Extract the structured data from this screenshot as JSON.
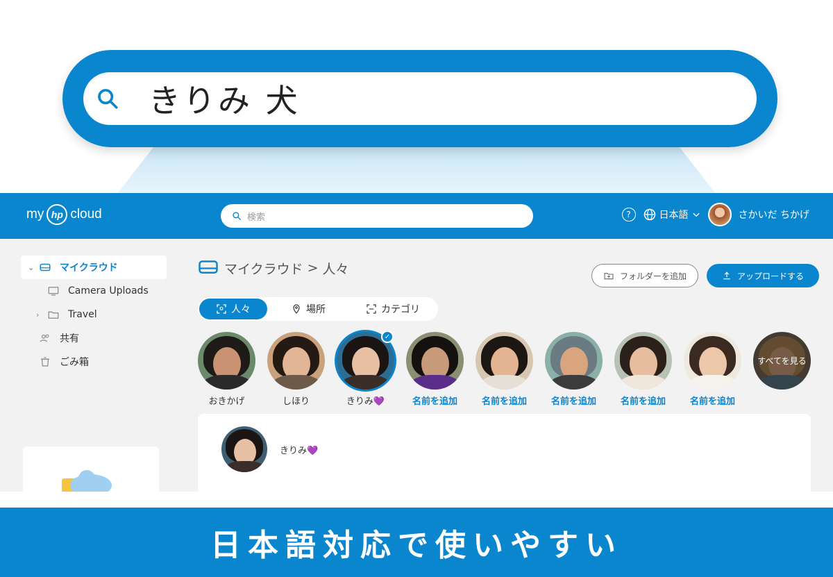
{
  "zoom": {
    "query": "きりみ 犬"
  },
  "header": {
    "logo": {
      "my": "my",
      "hp": "hp",
      "cloud": "cloud"
    },
    "search_placeholder": "検索",
    "help_icon": "?",
    "language": "日本語",
    "user_name": "さかいだ ちかげ"
  },
  "sidebar": {
    "items": [
      {
        "label": "マイクラウド"
      },
      {
        "label": "Camera Uploads"
      },
      {
        "label": "Travel"
      },
      {
        "label": "共有"
      },
      {
        "label": "ごみ箱"
      }
    ]
  },
  "main": {
    "breadcrumb": {
      "root": "マイクラウド",
      "sep": ">",
      "current": "人々"
    },
    "add_folder_label": "フォルダーを追加",
    "upload_label": "アップロードする",
    "tabs": [
      {
        "label": "人々"
      },
      {
        "label": "場所"
      },
      {
        "label": "カテゴリ"
      }
    ],
    "people": [
      {
        "name": "おきかげ"
      },
      {
        "name": "しほり"
      },
      {
        "name": "きりみ💜"
      },
      {
        "name": "名前を追加"
      },
      {
        "name": "名前を追加"
      },
      {
        "name": "名前を追加"
      },
      {
        "name": "名前を追加"
      },
      {
        "name": "名前を追加"
      }
    ],
    "see_all_label": "すべてを見る",
    "panel_name": "きりみ💜"
  },
  "banner": {
    "text": "日本語対応で使いやすい"
  },
  "colors": {
    "brand": "#0a86cf",
    "background": "#f2f2f2"
  }
}
